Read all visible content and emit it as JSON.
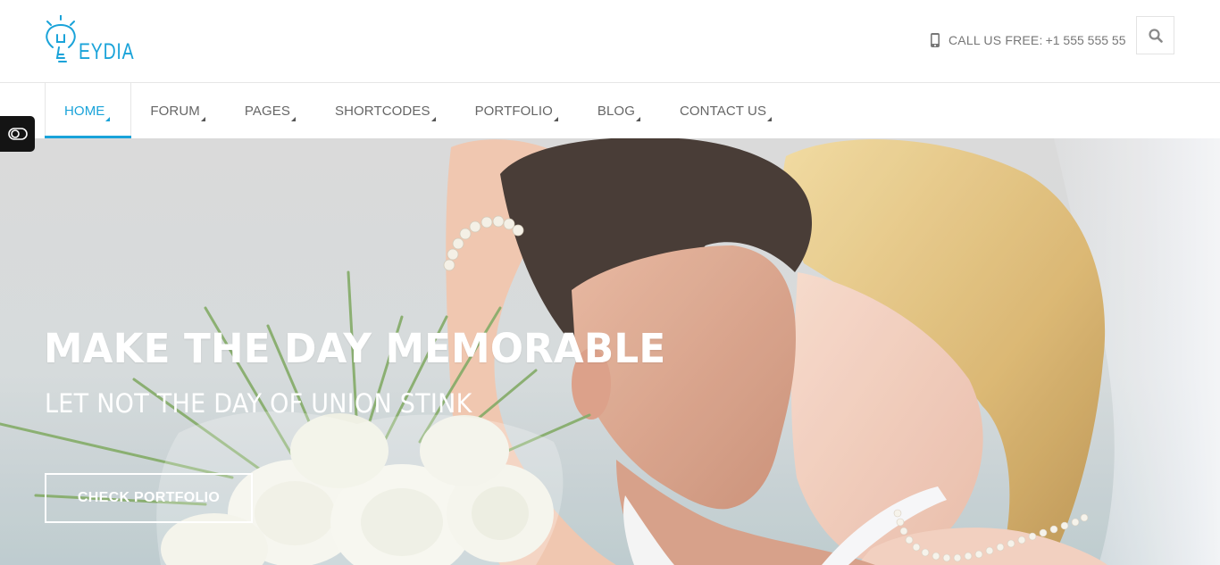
{
  "header": {
    "logo_text": "EYDIA",
    "call_label": "CALL US FREE:",
    "call_number": "+1 555 555 55",
    "icons": {
      "phone": "phone-icon",
      "search": "search-icon",
      "logo": "lightbulb-icon"
    }
  },
  "nav": {
    "items": [
      {
        "label": "HOME"
      },
      {
        "label": "FORUM"
      },
      {
        "label": "PAGES"
      },
      {
        "label": "SHORTCODES"
      },
      {
        "label": "PORTFOLIO"
      },
      {
        "label": "BLOG"
      },
      {
        "label": "CONTACT US"
      }
    ],
    "active_index": 0
  },
  "side_toggle": {
    "icon": "toggle-switch-icon"
  },
  "hero": {
    "title": "MAKE THE DAY MEMORABLE",
    "subtitle": "LET NOT THE DAY OF UNION STINK",
    "button_label": "CHECK PORTFOLIO"
  },
  "colors": {
    "accent": "#1aa3d9",
    "nav_text": "#666666",
    "hero_text": "#ffffff",
    "toggle_bg": "#141414"
  }
}
